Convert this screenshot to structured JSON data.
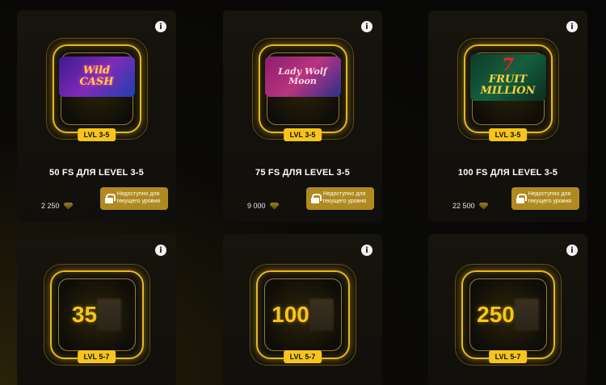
{
  "cards": [
    {
      "info": "i",
      "thumb": {
        "line1": "Wild",
        "line2": "CASH"
      },
      "level": "LVL 3-5",
      "title": "50 FS ДЛЯ LEVEL 3-5",
      "price": "2 250",
      "lock_line1": "Недоступно для",
      "lock_line2": "текущего уровня"
    },
    {
      "info": "i",
      "thumb": {
        "line1": "Lady Wolf",
        "line2": "Moon"
      },
      "level": "LVL 3-5",
      "title": "75 FS ДЛЯ LEVEL 3-5",
      "price": "9 000",
      "lock_line1": "Недоступно для",
      "lock_line2": "текущего уровня"
    },
    {
      "info": "i",
      "thumb": {
        "line0": "7",
        "line1": "FRUIT",
        "line2": "MILLION"
      },
      "level": "LVL 3-5",
      "title": "100 FS ДЛЯ LEVEL 3-5",
      "price": "22 500",
      "lock_line1": "Недоступно для",
      "lock_line2": "текущего уровня"
    },
    {
      "info": "i",
      "amount": "35",
      "level": "LVL 5-7"
    },
    {
      "info": "i",
      "amount": "100",
      "level": "LVL 5-7"
    },
    {
      "info": "i",
      "amount": "250",
      "level": "LVL 5-7"
    }
  ],
  "colors": {
    "accent": "#f7c51a",
    "button": "#b08a20",
    "card_bg": "#15120c",
    "page_bg": "#0b0a07"
  }
}
